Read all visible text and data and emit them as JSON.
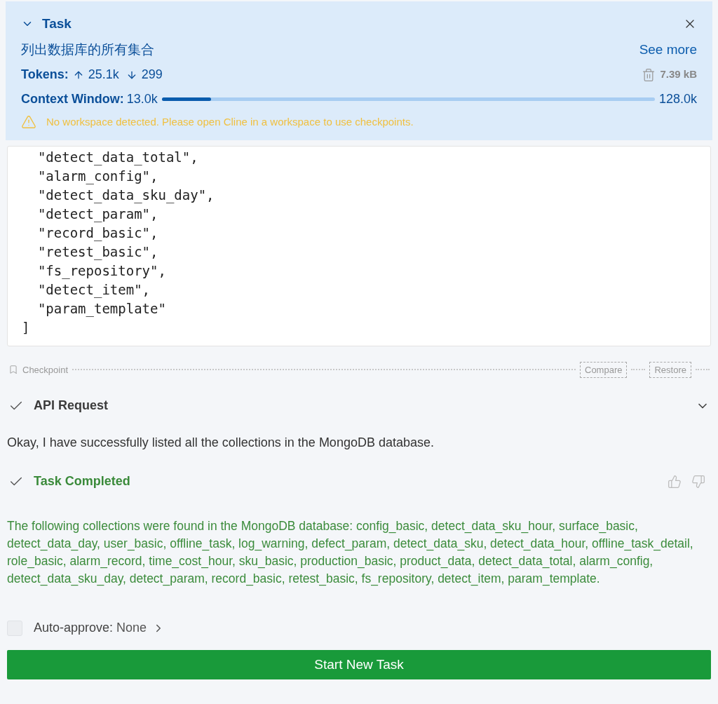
{
  "task": {
    "title": "Task",
    "expanded": true,
    "prompt": "列出数据库的所有集合",
    "see_more": "See more",
    "tokens_label": "Tokens:",
    "tokens_up": "25.1k",
    "tokens_down": "299",
    "size": "7.39 kB",
    "context_window": {
      "label": "Context Window:",
      "used": "13.0k",
      "level": 0.1,
      "max": "128.0k"
    },
    "warning": "No workspace detected. Please open Cline in a workspace to use checkpoints."
  },
  "code_lines": [
    "  \"detect_data_total\",",
    "  \"alarm_config\",",
    "  \"detect_data_sku_day\",",
    "  \"detect_param\",",
    "  \"record_basic\",",
    "  \"retest_basic\",",
    "  \"fs_repository\",",
    "  \"detect_item\",",
    "  \"param_template\"",
    "]"
  ],
  "checkpoint": {
    "label": "Checkpoint",
    "buttons": [
      "Compare",
      "Restore"
    ]
  },
  "messages": [
    {
      "kind": "api",
      "title": "API Request",
      "expanded": false
    },
    {
      "kind": "text",
      "text": "Okay, I have successfully listed all the collections in the MongoDB database."
    },
    {
      "kind": "completed",
      "title": "Task Completed"
    },
    {
      "kind": "result",
      "text": "The following collections were found in the MongoDB database: config_basic, detect_data_sku_hour, surface_basic, detect_data_day, user_basic, offline_task, log_warning, defect_param, detect_data_sku, detect_data_hour, offline_task_detail, role_basic, alarm_record, time_cost_hour, sku_basic, production_basic, product_data, detect_data_total, alarm_config, detect_data_sku_day, detect_param, record_basic, retest_basic, fs_repository, detect_item, param_template."
    }
  ],
  "auto_approve": {
    "checked": false,
    "label": "Auto-approve:",
    "value": "None"
  },
  "primary_button": "Start New Task"
}
